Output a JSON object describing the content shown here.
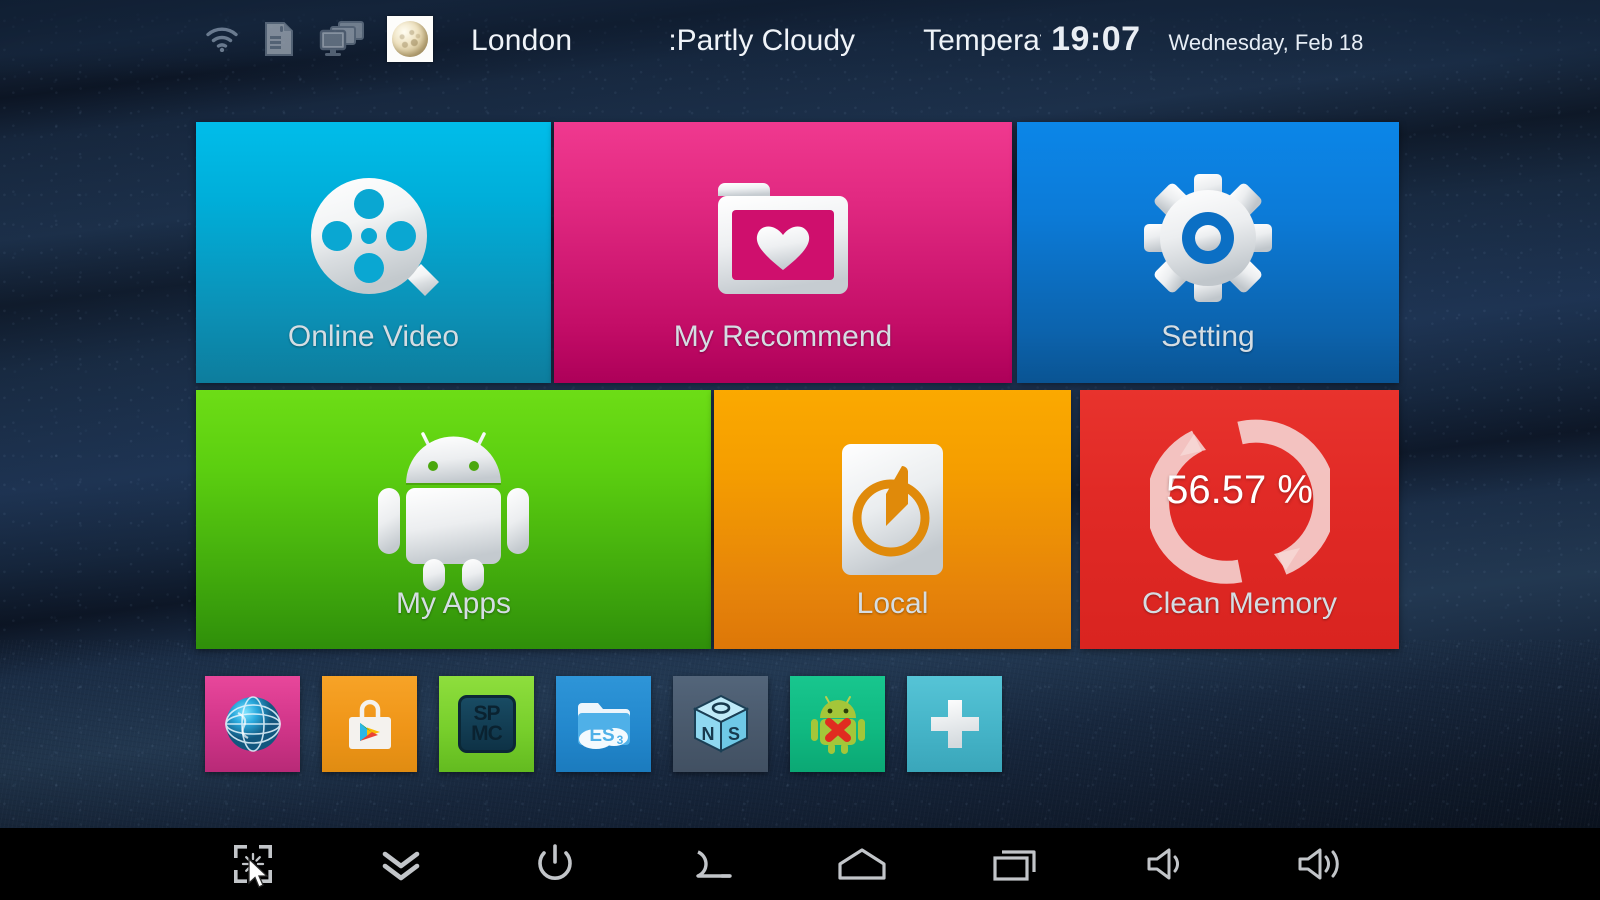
{
  "statusbar": {
    "icons": [
      {
        "name": "wifi-icon",
        "label": "Wi-Fi"
      },
      {
        "name": "sdcard-icon",
        "label": "SD Card"
      },
      {
        "name": "displays-icon",
        "label": "Displays"
      },
      {
        "name": "moon-weather-icon",
        "label": "Moon"
      }
    ],
    "city": "London",
    "weather": ":Partly Cloudy",
    "temperature": "Temperature",
    "time": "19:07",
    "date": "Wednesday, Feb 18"
  },
  "tiles": [
    {
      "id": "online",
      "label": "Online Video",
      "icon": "film-reel-icon",
      "color": "#00aed9"
    },
    {
      "id": "recommend",
      "label": "My Recommend",
      "icon": "folder-heart-icon",
      "color": "#d2107a"
    },
    {
      "id": "setting",
      "label": "Setting",
      "icon": "gear-icon",
      "color": "#0c7bd8"
    },
    {
      "id": "apps",
      "label": "My Apps",
      "icon": "android-robot-icon",
      "color": "#5ccf10"
    },
    {
      "id": "local",
      "label": "Local",
      "icon": "disk-drive-icon",
      "color": "#f59e00"
    },
    {
      "id": "memory",
      "label": "Clean Memory",
      "icon": "refresh-ring-icon",
      "color": "#d92420",
      "value": "56.57 %"
    }
  ],
  "dock": [
    {
      "id": "browser",
      "name": "browser-globe-icon",
      "label": "Browser"
    },
    {
      "id": "play",
      "name": "play-store-icon",
      "label": "Play Store"
    },
    {
      "id": "spmc",
      "name": "spmc-icon",
      "label": "SPMC"
    },
    {
      "id": "es",
      "name": "es-file-explorer-icon",
      "label": "ES File Explorer"
    },
    {
      "id": "ns",
      "name": "ns-cube-icon",
      "label": "NS"
    },
    {
      "id": "uninst",
      "name": "app-uninstaller-icon",
      "label": "Uninstaller"
    },
    {
      "id": "add",
      "name": "add-shortcut-icon",
      "label": "Add"
    }
  ],
  "navbar": [
    {
      "id": "screenshot",
      "name": "screenshot-icon",
      "label": "Screenshot"
    },
    {
      "id": "collapse",
      "name": "chevron-double-down-icon",
      "label": "Hide bar"
    },
    {
      "id": "power",
      "name": "power-icon",
      "label": "Power"
    },
    {
      "id": "back",
      "name": "back-arrow-icon",
      "label": "Back"
    },
    {
      "id": "home",
      "name": "home-icon",
      "label": "Home"
    },
    {
      "id": "recents",
      "name": "recent-apps-icon",
      "label": "Recent apps"
    },
    {
      "id": "voldown",
      "name": "volume-down-icon",
      "label": "Volume down"
    },
    {
      "id": "volup",
      "name": "volume-up-icon",
      "label": "Volume up"
    }
  ],
  "spmc_text": {
    "line1": "SP",
    "line2": "MC"
  },
  "es_text": {
    "main": "ES",
    "sub": "3"
  },
  "ns_text": {
    "front": "N",
    "side": "S",
    "top": "O"
  }
}
